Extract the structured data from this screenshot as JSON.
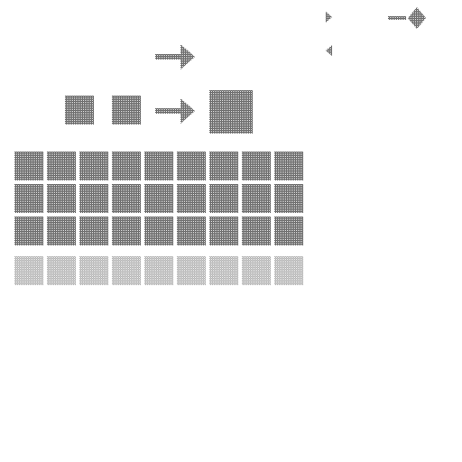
{
  "sprite_sheet": {
    "background_color": "#ffffff",
    "tile_dark_color": "#6a6a6a",
    "tile_light_color": "#b8b8b8",
    "arrow_color": "#6a6a6a",
    "top_icons": [
      {
        "name": "play-right-icon",
        "icon": "triangle-right"
      },
      {
        "name": "play-left-icon",
        "icon": "triangle-left"
      },
      {
        "name": "arrow-to-diamond-icon",
        "icon": "arrow-diamond"
      }
    ],
    "arrow_icons": [
      {
        "name": "arrow-right-icon",
        "icon": "arrow-right"
      },
      {
        "name": "merge-arrow-icon",
        "icon": "arrow-right"
      }
    ],
    "merge_example": {
      "inputs": 2,
      "outputs": 1
    },
    "grid": {
      "columns": 9,
      "dark_rows": 3,
      "light_rows": 1
    }
  }
}
